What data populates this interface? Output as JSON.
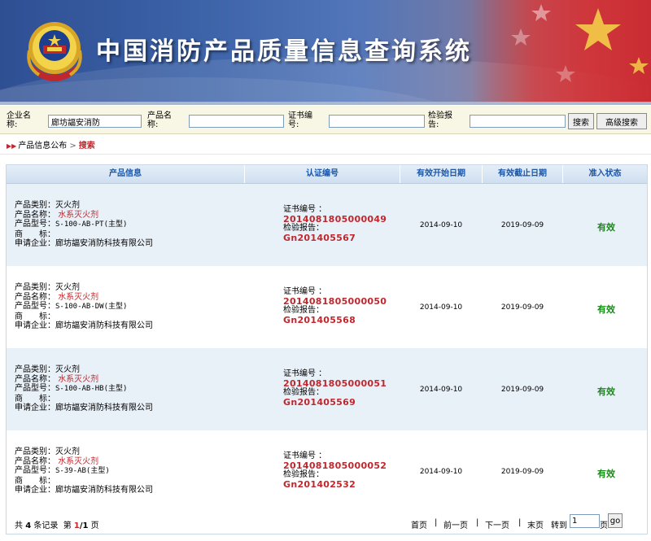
{
  "header": {
    "title": "中国消防产品质量信息查询系统",
    "colors": {
      "banner_blue": "#3c62a7",
      "flag_red": "#d5383c",
      "star_yellow": "#f6d64a"
    },
    "emblem_icon": "police-emblem-icon"
  },
  "search": {
    "company_label": "企业名称:",
    "company_value": "廊坊諨安消防",
    "product_label": "产品名称:",
    "product_value": "",
    "cert_label": "证书编号:",
    "cert_value": "",
    "report_label": "检验报告:",
    "report_value": "",
    "search_button": "搜索",
    "advanced_button": "高级搜索"
  },
  "breadcrumb": {
    "icon": "double-arrow-icon",
    "parent": "产品信息公布",
    "separator": ">",
    "current": "搜索"
  },
  "table": {
    "headers": [
      "产品信息",
      "认证编号",
      "有效开始日期",
      "有效截止日期",
      "准入状态"
    ],
    "field_labels": {
      "category": "产品类别：",
      "name": "产品名称：",
      "model": "产品型号：",
      "brand": "商　　标：",
      "company": "申请企业：",
      "cert_label": "证书编号 ：",
      "report_label": "检验报告："
    },
    "rows": [
      {
        "category": "灭火剂",
        "name": "水系灭火剂",
        "model": "S-100-AB-PT(主型)",
        "brand": "",
        "company": "廊坊諨安消防科技有限公司",
        "cert_no": "2014081805000049",
        "report_no": "Gn201405567",
        "start": "2014-09-10",
        "end": "2019-09-09",
        "status": "有效"
      },
      {
        "category": "灭火剂",
        "name": "水系灭火剂",
        "model": "S-100-AB-DW(主型)",
        "brand": "",
        "company": "廊坊諨安消防科技有限公司",
        "cert_no": "2014081805000050",
        "report_no": "Gn201405568",
        "start": "2014-09-10",
        "end": "2019-09-09",
        "status": "有效"
      },
      {
        "category": "灭火剂",
        "name": "水系灭火剂",
        "model": "S-100-AB-HB(主型)",
        "brand": "",
        "company": "廊坊諨安消防科技有限公司",
        "cert_no": "2014081805000051",
        "report_no": "Gn201405569",
        "start": "2014-09-10",
        "end": "2019-09-09",
        "status": "有效"
      },
      {
        "category": "灭火剂",
        "name": "水系灭火剂",
        "model": "S-39-AB(主型)",
        "brand": "",
        "company": "廊坊諨安消防科技有限公司",
        "cert_no": "2014081805000052",
        "report_no": "Gn201402532",
        "start": "2014-09-10",
        "end": "2019-09-09",
        "status": "有效"
      }
    ]
  },
  "pager": {
    "total_prefix": "共",
    "total": "4",
    "total_suffix": "条记录",
    "page_prefix": "第",
    "page_current": "1",
    "page_slash": "/",
    "page_total": "1",
    "page_suffix": "页",
    "first": "首页",
    "prev": "前一页",
    "next": "下一页",
    "last": "末页",
    "goto_label": "转到",
    "goto_value": "1",
    "goto_suffix": "页",
    "go_button": "go",
    "separator": "|"
  }
}
